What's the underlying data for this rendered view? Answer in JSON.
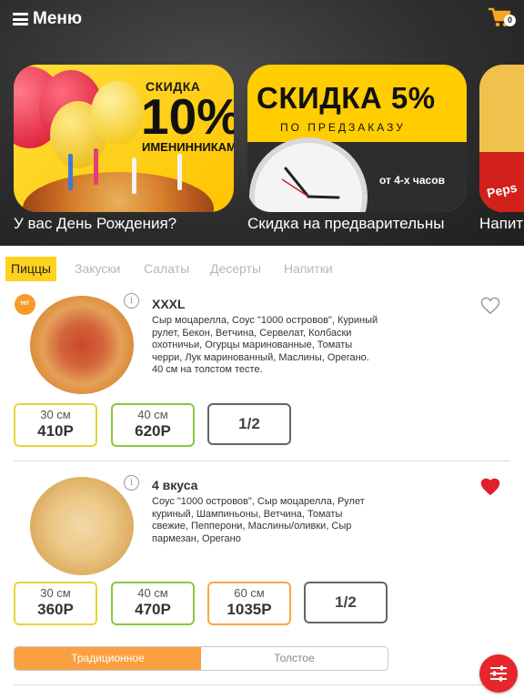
{
  "header": {
    "menu_label": "Меню",
    "cart_count": "0",
    "colors": {
      "background": "#2e2e2e",
      "cart": "#f5a623"
    }
  },
  "banners": [
    {
      "caption": "У вас День Рождения?",
      "discount_label": "СКИДКА",
      "discount_value": "10%",
      "sub_label": "ИМЕНИННИКАМ"
    },
    {
      "caption": "Скидка на предварительны",
      "headline": "СКИДКА 5%",
      "sub_label": "ПО ПРЕДЗАКАЗУ",
      "note": "от 4-х часов"
    },
    {
      "caption": "Напит",
      "brand": "Peps"
    }
  ],
  "tabs": [
    {
      "label": "Пиццы",
      "active": true
    },
    {
      "label": "Закуски",
      "active": false
    },
    {
      "label": "Салаты",
      "active": false
    },
    {
      "label": "Десерты",
      "active": false
    },
    {
      "label": "Напитки",
      "active": false
    }
  ],
  "products": [
    {
      "badge": "HIT",
      "title": "XXXL",
      "description": "Сыр моцарелла, Соус \"1000 островов\", Куриный рулет, Бекон, Ветчина, Сервелат, Колбаски охотничьи, Огурцы маринованные, Томаты черри, Лук маринованный, Маслины, Орегано. 40 см на толстом тесте.",
      "favorite": false,
      "sizes": [
        {
          "size": "30 см",
          "price": "410Р",
          "color": "#e8d43a"
        },
        {
          "size": "40 см",
          "price": "620Р",
          "color": "#8cc63f"
        }
      ],
      "half_label": "1/2"
    },
    {
      "title": "4 вкуса",
      "description": "Соус \"1000 островов\", Сыр моцарелла, Рулет куриный, Шампиньоны, Ветчина, Томаты свежие, Пепперони, Маслины/оливки, Сыр пармезан, Орегано",
      "favorite": true,
      "sizes": [
        {
          "size": "30 см",
          "price": "360Р",
          "color": "#e8d43a"
        },
        {
          "size": "40 см",
          "price": "470Р",
          "color": "#8cc63f"
        },
        {
          "size": "60 см",
          "price": "1035Р",
          "color": "#f5a94a"
        }
      ],
      "half_label": "1/2",
      "dough_options": [
        {
          "label": "Традиционное",
          "active": true
        },
        {
          "label": "Толстое",
          "active": false
        }
      ]
    }
  ],
  "icons": [
    "hamburger-icon",
    "cart-icon",
    "info-icon",
    "heart-icon",
    "filter-icon"
  ]
}
